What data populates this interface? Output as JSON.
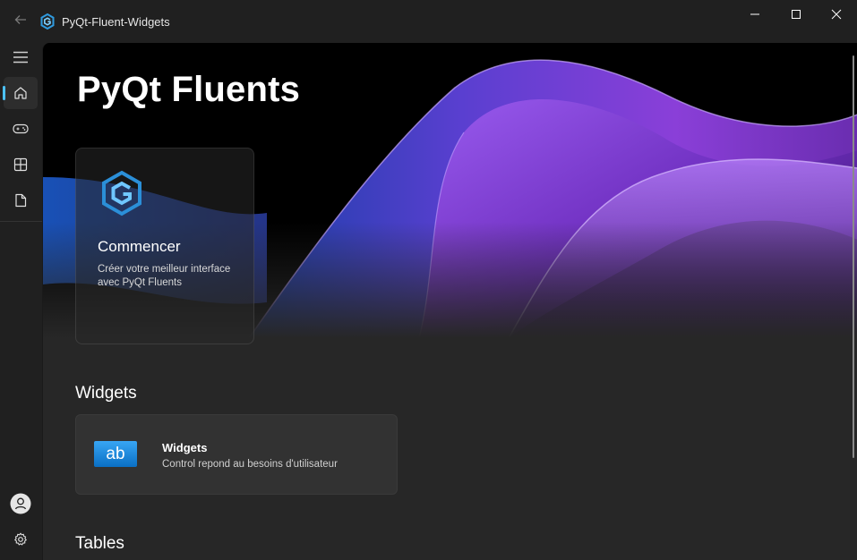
{
  "window": {
    "title": "PyQt-Fluent-Widgets",
    "back_icon": "back-arrow-icon",
    "controls": [
      "minimize",
      "maximize",
      "close"
    ]
  },
  "sidebar": {
    "items": [
      {
        "name": "menu",
        "icon": "hamburger-icon"
      },
      {
        "name": "home",
        "icon": "home-icon",
        "active": true
      },
      {
        "name": "gaming",
        "icon": "gamepad-icon"
      },
      {
        "name": "gallery",
        "icon": "grid-icon"
      },
      {
        "name": "document",
        "icon": "document-icon"
      }
    ],
    "bottom": [
      {
        "name": "account",
        "icon": "avatar-icon"
      },
      {
        "name": "settings",
        "icon": "gear-icon"
      }
    ],
    "accent": "#4cc2ff"
  },
  "banner": {
    "title": "PyQt Fluents",
    "card": {
      "title": "Commencer",
      "description": "Créer votre meilleur interface avec PyQt Fluents"
    }
  },
  "sections": {
    "widgets": {
      "title": "Widgets",
      "card": {
        "icon_text": "ab",
        "title": "Widgets",
        "description": "Control repond au besoins d'utilisateur"
      }
    },
    "tables": {
      "title": "Tables"
    }
  },
  "colors": {
    "background": "#202020",
    "content": "#272727",
    "accent": "#4cc2ff",
    "wave_purple": "#8b3fd6"
  }
}
